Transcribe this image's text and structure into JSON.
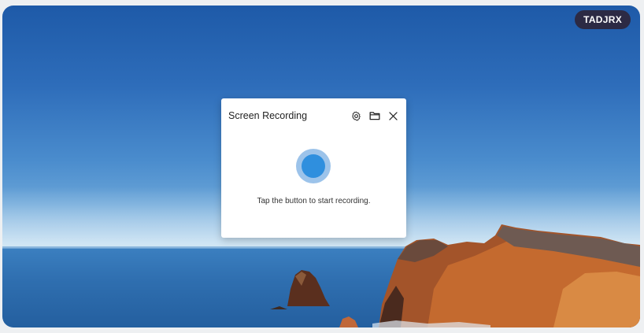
{
  "badge": {
    "label": "TADJRX"
  },
  "dialog": {
    "title": "Screen Recording",
    "hint": "Tap the button to start recording.",
    "icons": {
      "settings": "gear-icon",
      "folder": "folder-icon",
      "close": "close-icon"
    }
  },
  "colors": {
    "badge_bg": "#2c2a44",
    "record_outer": "#9cc3ea",
    "record_inner": "#2f8fde"
  }
}
